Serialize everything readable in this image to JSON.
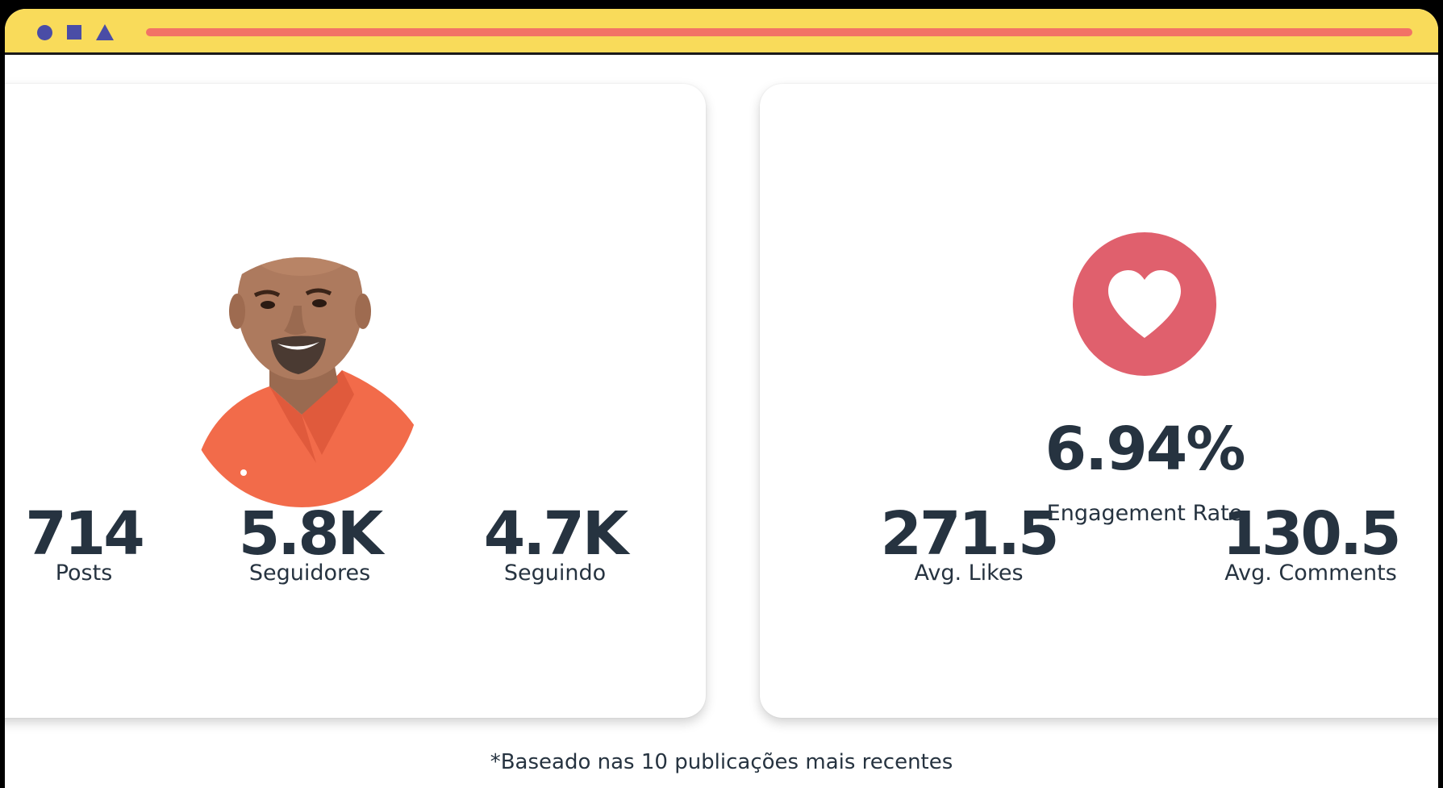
{
  "profile": {
    "stats": [
      {
        "value": "714",
        "label": "Posts"
      },
      {
        "value": "5.8K",
        "label": "Seguidores"
      },
      {
        "value": "4.7K",
        "label": "Seguindo"
      }
    ]
  },
  "engagement": {
    "rate": "6.94%",
    "rate_label": "Engagement Rate",
    "stats": [
      {
        "value": "271.5",
        "label": "Avg. Likes"
      },
      {
        "value": "130.5",
        "label": "Avg. Comments"
      }
    ]
  },
  "footnote": "*Baseado nas 10 publicações mais recentes",
  "icons": {
    "engagement": "heart-icon"
  },
  "colors": {
    "titlebar": "#f9db5a",
    "address_bar": "#f27366",
    "window_controls": "#4a4da6",
    "heart_badge": "#e0606d",
    "text": "#263340",
    "shirt": "#f26b4a"
  }
}
